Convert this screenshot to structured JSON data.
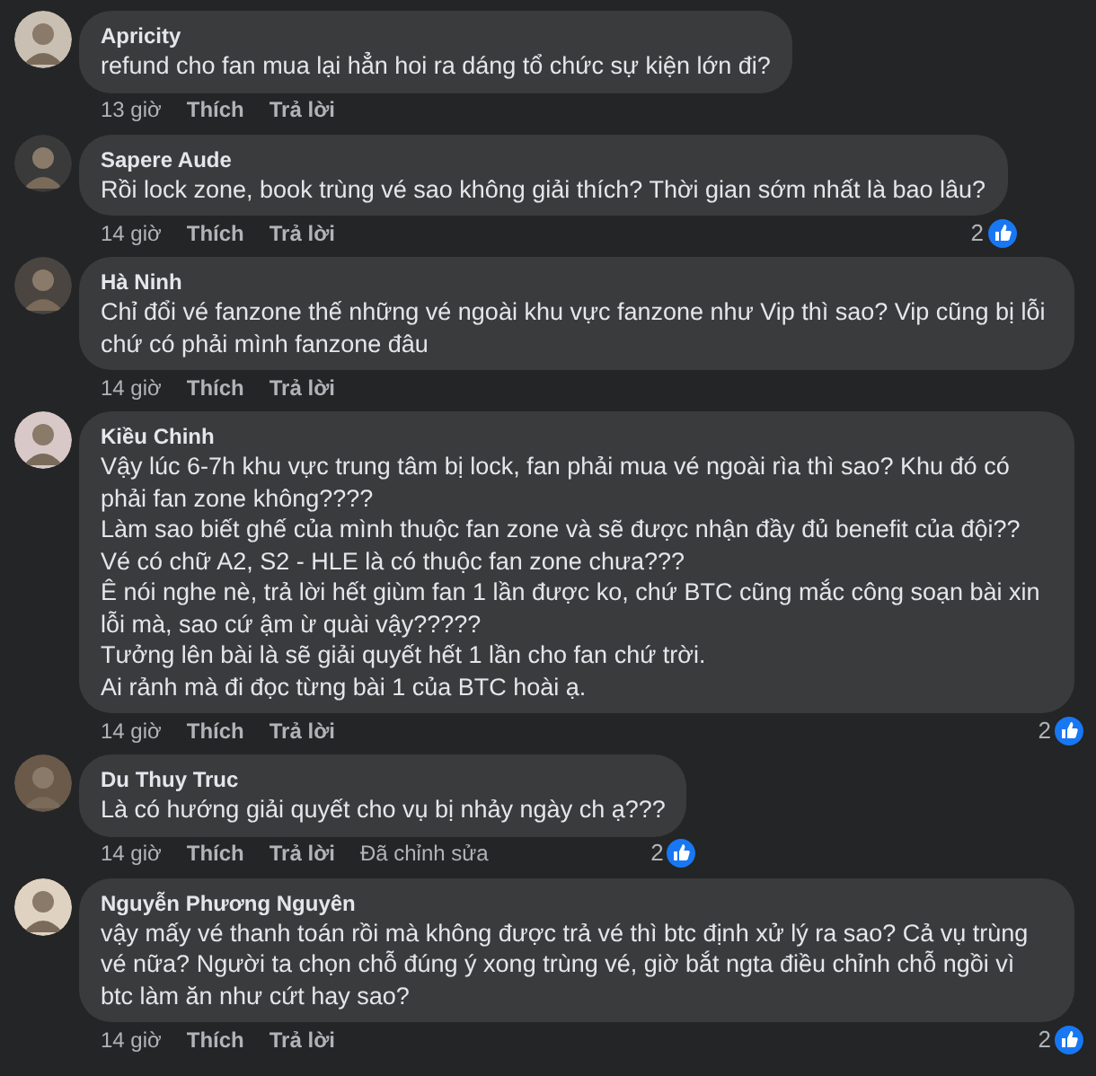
{
  "comments": [
    {
      "author": "Apricity",
      "lines": [
        "refund cho fan mua lại hẳn hoi ra dáng tổ chức sự kiện lớn đi?"
      ],
      "time": "13 giờ",
      "like": "Thích",
      "reply": "Trả lời"
    },
    {
      "author": "Sapere Aude",
      "lines": [
        "Rồi lock zone, book trùng vé sao không giải thích? Thời gian sớm nhất là bao lâu?"
      ],
      "time": "14 giờ",
      "like": "Thích",
      "reply": "Trả lời",
      "reactions": "2"
    },
    {
      "author": "Hà Ninh",
      "lines": [
        "Chỉ đổi vé fanzone thế những vé ngoài khu vực fanzone như Vip thì sao? Vip cũng bị lỗi chứ có phải mình fanzone đâu"
      ],
      "time": "14 giờ",
      "like": "Thích",
      "reply": "Trả lời"
    },
    {
      "author": "Kiều Chinh",
      "lines": [
        "Vậy lúc 6-7h khu vực trung tâm bị lock, fan phải mua vé ngoài rìa thì sao? Khu đó có phải fan zone không????",
        "Làm sao biết ghế của mình thuộc fan zone và sẽ được nhận đầy đủ benefit của đội??",
        "Vé có chữ A2, S2 - HLE là có thuộc fan zone chưa???",
        "Ê nói nghe nè, trả lời hết giùm fan 1 lần được ko, chứ BTC cũng mắc công soạn bài xin lỗi mà, sao cứ ậm ừ quài vậy?????",
        "Tưởng lên bài là sẽ giải quyết hết 1 lần cho fan chứ trời.",
        "Ai rảnh mà đi đọc từng bài 1 của BTC hoài ạ."
      ],
      "time": "14 giờ",
      "like": "Thích",
      "reply": "Trả lời",
      "reactions": "2"
    },
    {
      "author": "Du Thuy Truc",
      "lines": [
        "Là có hướng giải quyết cho vụ bị nhảy ngày ch ạ???"
      ],
      "time": "14 giờ",
      "like": "Thích",
      "reply": "Trả lời",
      "edited": "Đã chỉnh sửa",
      "reactions": "2"
    },
    {
      "author": "Nguyễn Phương Nguyên",
      "lines": [
        "vậy mấy vé thanh toán rồi mà không được trả vé thì btc định xử lý ra sao? Cả vụ trùng vé nữa? Người ta chọn chỗ đúng ý xong trùng vé, giờ bắt ngta điều chỉnh chỗ ngồi vì btc làm ăn như cứt hay sao?"
      ],
      "time": "14 giờ",
      "like": "Thích",
      "reply": "Trả lời",
      "reactions": "2"
    }
  ]
}
